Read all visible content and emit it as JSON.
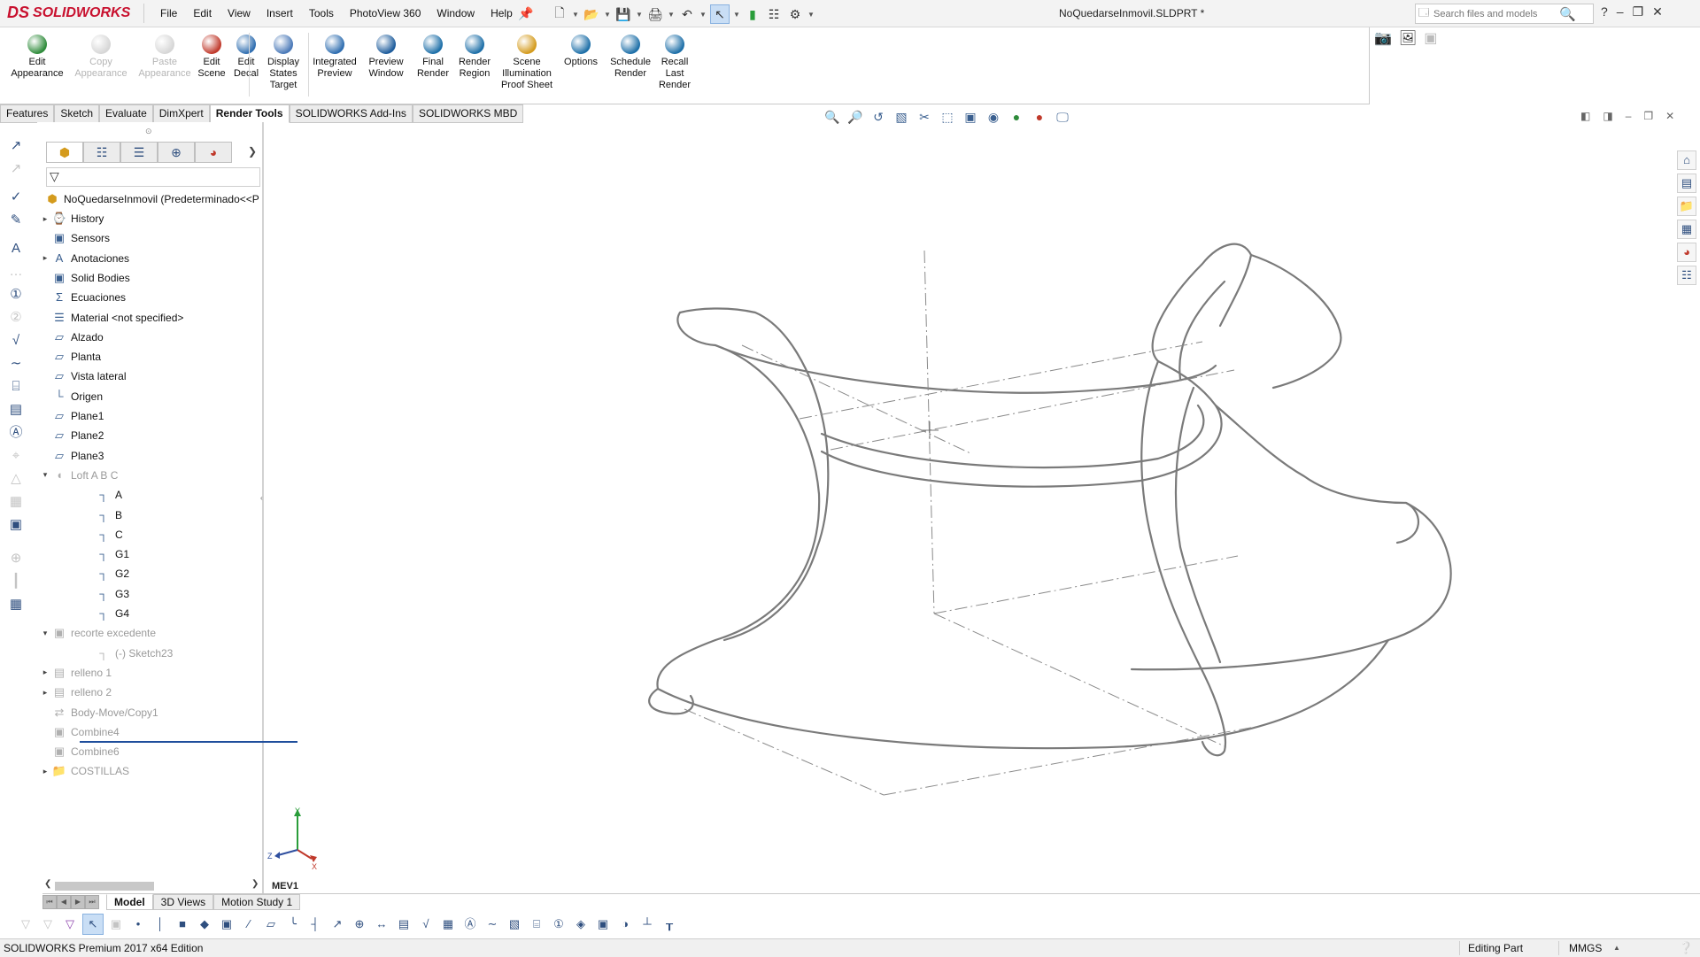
{
  "app": {
    "logo_ds": "DS",
    "logo_text": "SOLIDWORKS",
    "document_title": "NoQuedarseInmovil.SLDPRT *",
    "menu": [
      "File",
      "Edit",
      "View",
      "Insert",
      "Tools",
      "PhotoView 360",
      "Window",
      "Help"
    ],
    "search_placeholder": "Search files and models",
    "help_glyph": "?"
  },
  "command_manager": {
    "buttons": [
      {
        "label": "Edit\nAppearance",
        "enabled": true,
        "icon": "edit-appearance-icon",
        "color": "#2e8b3a"
      },
      {
        "label": "Copy\nAppearance",
        "enabled": false,
        "icon": "copy-appearance-icon",
        "color": "#8a8a8a"
      },
      {
        "label": "Paste\nAppearance",
        "enabled": false,
        "icon": "paste-appearance-icon",
        "color": "#8a8a8a"
      },
      {
        "label": "Edit\nScene",
        "enabled": true,
        "icon": "edit-scene-icon",
        "color": "#c0392b"
      },
      {
        "label": "Edit\nDecal",
        "enabled": true,
        "icon": "edit-decal-icon",
        "color": "#2f6eb0"
      },
      {
        "label": "Display\nStates\nTarget",
        "enabled": true,
        "icon": "display-states-icon",
        "color": "#4a79b8"
      },
      {
        "label": "Integrated\nPreview",
        "enabled": true,
        "icon": "integrated-preview-icon",
        "color": "#2f6eb0"
      },
      {
        "label": "Preview\nWindow",
        "enabled": true,
        "icon": "preview-window-icon",
        "color": "#1d5c9c"
      },
      {
        "label": "Final\nRender",
        "enabled": true,
        "icon": "final-render-icon",
        "color": "#1d6fa8"
      },
      {
        "label": "Render\nRegion",
        "enabled": true,
        "icon": "render-region-icon",
        "color": "#1d6fa8"
      },
      {
        "label": "Scene\nIllumination\nProof Sheet",
        "enabled": true,
        "icon": "proof-sheet-icon",
        "color": "#d49b1d"
      },
      {
        "label": "Options",
        "enabled": true,
        "icon": "options-icon",
        "color": "#1d6fa8"
      },
      {
        "label": "Schedule\nRender",
        "enabled": true,
        "icon": "schedule-render-icon",
        "color": "#1d6fa8"
      },
      {
        "label": "Recall\nLast\nRender",
        "enabled": true,
        "icon": "recall-last-render-icon",
        "color": "#1d6fa8"
      }
    ]
  },
  "tabs": [
    "Features",
    "Sketch",
    "Evaluate",
    "DimXpert",
    "Render Tools",
    "SOLIDWORKS Add-Ins",
    "SOLIDWORKS MBD"
  ],
  "active_tab": "Render Tools",
  "tree": {
    "root": "NoQuedarseInmovil  (Predeterminado<<P",
    "items": [
      {
        "label": "History",
        "expander": true,
        "icon": "history-icon",
        "dim": false,
        "indent": 0
      },
      {
        "label": "Sensors",
        "expander": false,
        "icon": "sensors-icon",
        "dim": false,
        "indent": 0
      },
      {
        "label": "Anotaciones",
        "expander": true,
        "icon": "annotations-icon",
        "dim": false,
        "indent": 0
      },
      {
        "label": "Solid Bodies",
        "expander": false,
        "icon": "solid-bodies-icon",
        "dim": false,
        "indent": 0
      },
      {
        "label": "Ecuaciones",
        "expander": false,
        "icon": "equations-icon",
        "dim": false,
        "indent": 0
      },
      {
        "label": "Material <not specified>",
        "expander": false,
        "icon": "material-icon",
        "dim": false,
        "indent": 0
      },
      {
        "label": "Alzado",
        "expander": false,
        "icon": "plane-icon",
        "dim": false,
        "indent": 0
      },
      {
        "label": "Planta",
        "expander": false,
        "icon": "plane-icon",
        "dim": false,
        "indent": 0
      },
      {
        "label": "Vista lateral",
        "expander": false,
        "icon": "plane-icon",
        "dim": false,
        "indent": 0
      },
      {
        "label": "Origen",
        "expander": false,
        "icon": "origin-icon",
        "dim": false,
        "indent": 0
      },
      {
        "label": "Plane1",
        "expander": false,
        "icon": "plane-icon",
        "dim": false,
        "indent": 0
      },
      {
        "label": "Plane2",
        "expander": false,
        "icon": "plane-icon",
        "dim": false,
        "indent": 0
      },
      {
        "label": "Plane3",
        "expander": false,
        "icon": "plane-icon",
        "dim": false,
        "indent": 0
      },
      {
        "label": "Loft A B C",
        "expander": "open",
        "icon": "loft-icon",
        "dim": true,
        "indent": 0
      },
      {
        "label": "A",
        "expander": false,
        "icon": "sketch-icon",
        "dim": false,
        "indent": 1
      },
      {
        "label": "B",
        "expander": false,
        "icon": "sketch-icon",
        "dim": false,
        "indent": 1
      },
      {
        "label": "C",
        "expander": false,
        "icon": "sketch-icon",
        "dim": false,
        "indent": 1
      },
      {
        "label": "G1",
        "expander": false,
        "icon": "sketch-icon",
        "dim": false,
        "indent": 1
      },
      {
        "label": "G2",
        "expander": false,
        "icon": "sketch-icon",
        "dim": false,
        "indent": 1
      },
      {
        "label": "G3",
        "expander": false,
        "icon": "sketch-icon",
        "dim": false,
        "indent": 1
      },
      {
        "label": "G4",
        "expander": false,
        "icon": "sketch-icon",
        "dim": false,
        "indent": 1
      },
      {
        "label": "recorte excedente",
        "expander": "open",
        "icon": "cut-icon",
        "dim": true,
        "indent": 0
      },
      {
        "label": "(-) Sketch23",
        "expander": false,
        "icon": "sketch-icon",
        "dim": true,
        "indent": 1
      },
      {
        "label": "relleno 1",
        "expander": true,
        "icon": "fill-icon",
        "dim": true,
        "indent": 0
      },
      {
        "label": "relleno 2",
        "expander": true,
        "icon": "fill-icon",
        "dim": true,
        "indent": 0
      },
      {
        "label": "Body-Move/Copy1",
        "expander": false,
        "icon": "move-copy-icon",
        "dim": true,
        "indent": 0
      },
      {
        "label": "Combine4",
        "expander": false,
        "icon": "combine-icon",
        "dim": true,
        "indent": 0
      },
      {
        "label": "Combine6",
        "expander": false,
        "icon": "combine-icon",
        "dim": true,
        "indent": 0
      },
      {
        "label": "COSTILLAS",
        "expander": true,
        "icon": "folder-icon",
        "dim": true,
        "indent": 0
      }
    ]
  },
  "viewport": {
    "view_label": "MEV1",
    "triad": {
      "x_label": "X",
      "y_label": "Y",
      "z_label": "Z"
    }
  },
  "bottom_tabs": [
    "Model",
    "3D Views",
    "Motion Study 1"
  ],
  "active_bottom_tab": "Model",
  "status": {
    "edition": "SOLIDWORKS Premium 2017 x64 Edition",
    "mode": "Editing Part",
    "units": "MMGS"
  },
  "colors": {
    "brand_red": "#c8102e",
    "icon_blue": "#2f4f7f",
    "selection_blue": "#c9def5",
    "model_edge": "#7a7a7a"
  }
}
